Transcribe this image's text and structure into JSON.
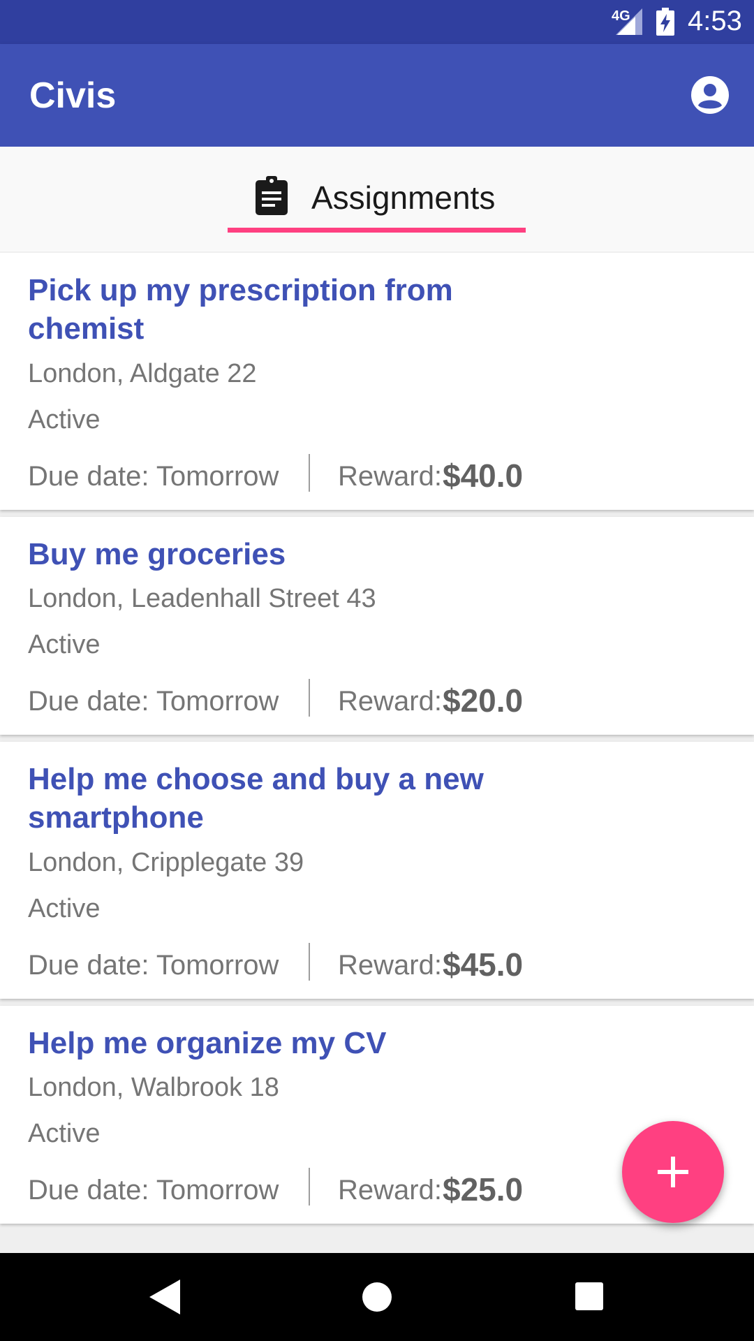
{
  "status_bar": {
    "network": "4G",
    "time": "4:53"
  },
  "app_bar": {
    "title": "Civis",
    "account_icon": "account-circle-icon"
  },
  "tabs": [
    {
      "label": "Assignments",
      "icon": "clipboard-icon",
      "selected": true
    }
  ],
  "assignments": [
    {
      "title": "Pick up my prescription from chemist",
      "address": "London, Aldgate 22",
      "status": "Active",
      "due_date": "Due date: Tomorrow",
      "reward_label": "Reward:",
      "reward_value": "$40.0"
    },
    {
      "title": "Buy me groceries",
      "address": "London, Leadenhall Street 43",
      "status": "Active",
      "due_date": "Due date: Tomorrow",
      "reward_label": "Reward:",
      "reward_value": "$20.0"
    },
    {
      "title": "Help me choose and buy a new smartphone",
      "address": "London, Cripplegate 39",
      "status": "Active",
      "due_date": "Due date: Tomorrow",
      "reward_label": "Reward:",
      "reward_value": "$45.0"
    },
    {
      "title": "Help me organize my CV",
      "address": "London, Walbrook 18",
      "status": "Active",
      "due_date": "Due date: Tomorrow",
      "reward_label": "Reward:",
      "reward_value": "$25.0"
    }
  ],
  "fab": {
    "icon": "plus-icon"
  },
  "nav_bar": {
    "back_icon": "back-icon",
    "home_icon": "home-icon",
    "recent_icon": "recent-apps-icon"
  },
  "colors": {
    "primary": "#3f51b5",
    "primary_dark": "#303f9f",
    "accent": "#ff4081"
  }
}
